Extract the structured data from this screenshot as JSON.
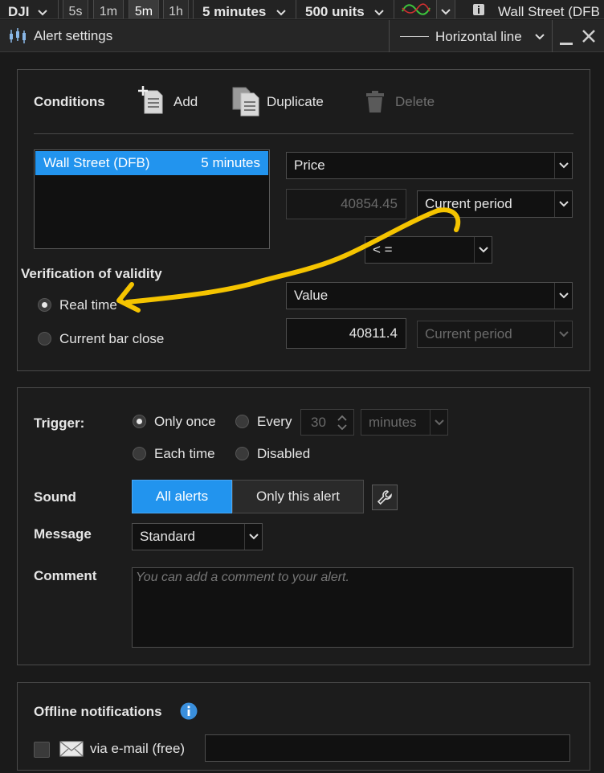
{
  "toolbar": {
    "symbol": "DJI",
    "periods": [
      "5s",
      "1m",
      "5m",
      "1h"
    ],
    "active_period": "5m",
    "timeframe": "5 minutes",
    "units": "500 units",
    "instrument": "Wall Street (DFB"
  },
  "window": {
    "title": "Alert settings",
    "drawing_type": "Horizontal line"
  },
  "conditions": {
    "heading": "Conditions",
    "add_label": "Add",
    "duplicate_label": "Duplicate",
    "delete_label": "Delete",
    "list_items": [
      {
        "name": "Wall Street (DFB)",
        "period": "5 minutes"
      }
    ],
    "left_operand": "Price",
    "left_value": "40854.45",
    "left_period": "Current period",
    "operator": "< =",
    "right_operand": "Value",
    "right_value": "40811.4",
    "right_period": "Current period"
  },
  "validity": {
    "heading": "Verification of validity",
    "options": [
      "Real time",
      "Current bar close"
    ],
    "selected": "Real time"
  },
  "trigger": {
    "label": "Trigger:",
    "only_once": "Only once",
    "every": "Every",
    "every_value": "30",
    "every_unit": "minutes",
    "each_time": "Each time",
    "disabled": "Disabled",
    "selected": "Only once"
  },
  "sound": {
    "label": "Sound",
    "all_alerts": "All alerts",
    "only_this_alert": "Only this alert",
    "selected": "All alerts"
  },
  "message": {
    "label": "Message",
    "value": "Standard"
  },
  "comment": {
    "label": "Comment",
    "placeholder": "You can add a comment to your alert."
  },
  "offline": {
    "heading": "Offline notifications",
    "email_label": "via e-mail (free)",
    "email_checked": false
  },
  "colors": {
    "accent": "#2294ee",
    "annotation": "#f5c400",
    "background": "#1a1a1a"
  }
}
